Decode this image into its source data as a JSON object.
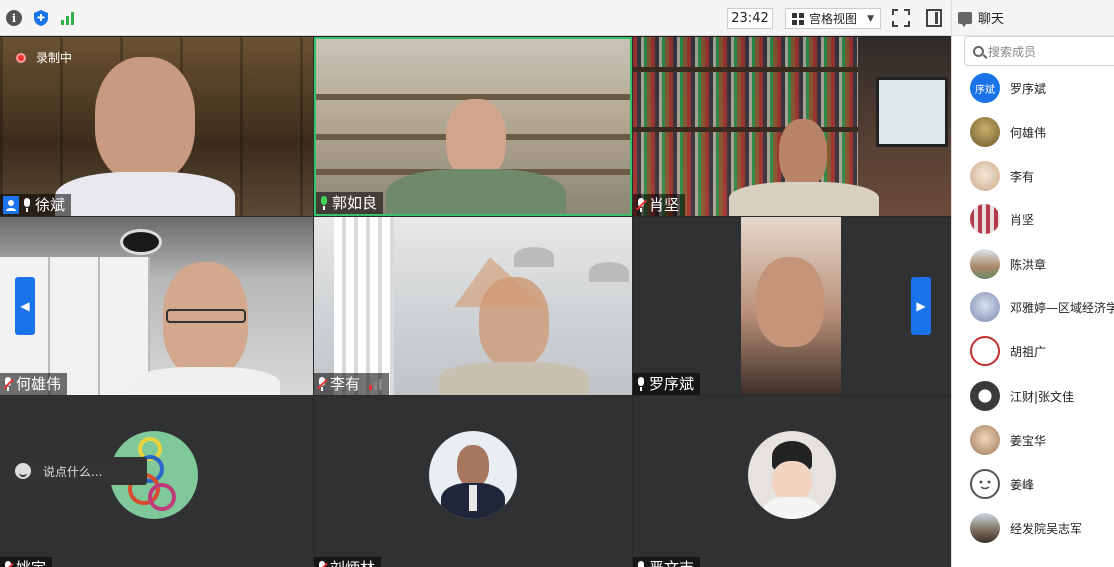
{
  "toolbar": {
    "timer": "23:42",
    "view_label": "宫格视图"
  },
  "chat": {
    "title": "聊天",
    "search_placeholder": "搜索成员",
    "input_placeholder": "说点什么..."
  },
  "recording": {
    "label": "录制中"
  },
  "tiles": [
    {
      "name": "徐斌",
      "mic": "on"
    },
    {
      "name": "郭如良",
      "mic": "on"
    },
    {
      "name": "肖坚",
      "mic": "muted"
    },
    {
      "name": "何雄伟",
      "mic": "muted"
    },
    {
      "name": "李有",
      "mic": "muted"
    },
    {
      "name": "罗序斌",
      "mic": "on"
    },
    {
      "name": "姚宇",
      "mic": "muted"
    },
    {
      "name": "刘炳林",
      "mic": "muted"
    },
    {
      "name": "严文吉",
      "mic": "muted"
    }
  ],
  "members": [
    {
      "name": "罗序斌",
      "avatar_text": "序斌",
      "color": "#1a73e8"
    },
    {
      "name": "何雄伟",
      "color": "#8a7a4a"
    },
    {
      "name": "李有",
      "color": "#d9c7b1"
    },
    {
      "name": "肖坚",
      "color": "#b23a4a"
    },
    {
      "name": "陈洪章",
      "color": "#6a8a6a"
    },
    {
      "name": "邓雅婷—区域经济学",
      "color": "#7a8ab0"
    },
    {
      "name": "胡祖广",
      "color": "#c03030"
    },
    {
      "name": "江财|张文佳",
      "color": "#3a3a3a"
    },
    {
      "name": "姜宝华",
      "color": "#9a7a5a"
    },
    {
      "name": "姜峰",
      "color": "#ffffff"
    },
    {
      "name": "经发院吴志军",
      "color": "#7a6a5a"
    }
  ]
}
